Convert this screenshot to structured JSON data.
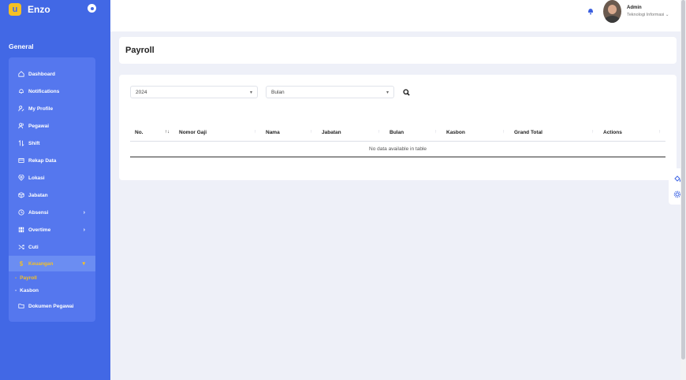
{
  "brand": {
    "name": "Enzo",
    "logo_glyph": "u"
  },
  "sidebar": {
    "section_title": "General",
    "items": [
      {
        "label": "Dashboard",
        "icon": "home-icon"
      },
      {
        "label": "Notifications",
        "icon": "bell-icon"
      },
      {
        "label": "My Profile",
        "icon": "user-edit-icon"
      },
      {
        "label": "Pegawai",
        "icon": "users-icon"
      },
      {
        "label": "Shift",
        "icon": "swap-icon"
      },
      {
        "label": "Rekap Data",
        "icon": "card-icon"
      },
      {
        "label": "Lokasi",
        "icon": "location-icon"
      },
      {
        "label": "Jabatan",
        "icon": "cube-icon"
      },
      {
        "label": "Absensi",
        "icon": "clock-icon",
        "chevron": "›"
      },
      {
        "label": "Overtime",
        "icon": "film-icon",
        "chevron": "›"
      },
      {
        "label": "Cuti",
        "icon": "shuffle-icon"
      },
      {
        "label": "Keuangan",
        "icon": "dollar-icon",
        "chevron": "▾"
      }
    ],
    "submenu": [
      {
        "label": "Payroll",
        "dash": "-"
      },
      {
        "label": "Kasbon",
        "dash": "-"
      }
    ],
    "extra_item": {
      "label": "Dokumen Pegawai",
      "icon": "folder-icon"
    }
  },
  "topbar": {
    "user_name": "Admin",
    "user_role": "Teknologi Informasi",
    "role_caret": "⌄"
  },
  "page": {
    "title": "Payroll"
  },
  "filters": {
    "year_value": "2024",
    "month_value": "Bulan",
    "caret": "▾"
  },
  "table": {
    "columns": [
      "No.",
      "Nomor Gaji",
      "Nama",
      "Jabatan",
      "Bulan",
      "Kasbon",
      "Grand Total",
      "Actions"
    ],
    "empty_message": "No data available in table"
  },
  "colors": {
    "sidebar": "#4268e5",
    "accent": "#f5c024",
    "background": "#eef0f8"
  }
}
